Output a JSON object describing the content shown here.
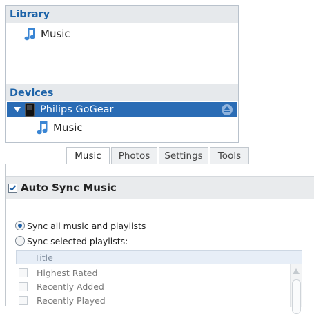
{
  "library": {
    "header": "Library",
    "items": [
      {
        "label": "Music",
        "icon": "music-note-icon"
      }
    ]
  },
  "devices": {
    "header": "Devices",
    "device": {
      "name": "Philips GoGear",
      "expanded": true,
      "icon": "player-device-icon",
      "eject_icon": "eject-icon"
    },
    "items": [
      {
        "label": "Music",
        "icon": "music-note-icon"
      }
    ]
  },
  "tabs": [
    {
      "label": "Music",
      "active": true
    },
    {
      "label": "Photos",
      "active": false
    },
    {
      "label": "Settings",
      "active": false
    },
    {
      "label": "Tools",
      "active": false
    }
  ],
  "auto_sync": {
    "label": "Auto Sync Music",
    "checked": true
  },
  "sync_options": [
    {
      "label": "Sync all music and playlists",
      "selected": true
    },
    {
      "label": "Sync selected playlists:",
      "selected": false
    }
  ],
  "playlist_table": {
    "column": "Title",
    "rows": [
      {
        "title": "Highest Rated",
        "checked": false
      },
      {
        "title": "Recently Added",
        "checked": false
      },
      {
        "title": "Recently Played",
        "checked": false
      }
    ]
  },
  "colors": {
    "accent": "#2a6cb5",
    "header_text": "#1d63a8",
    "icon": "#3b86d4"
  }
}
